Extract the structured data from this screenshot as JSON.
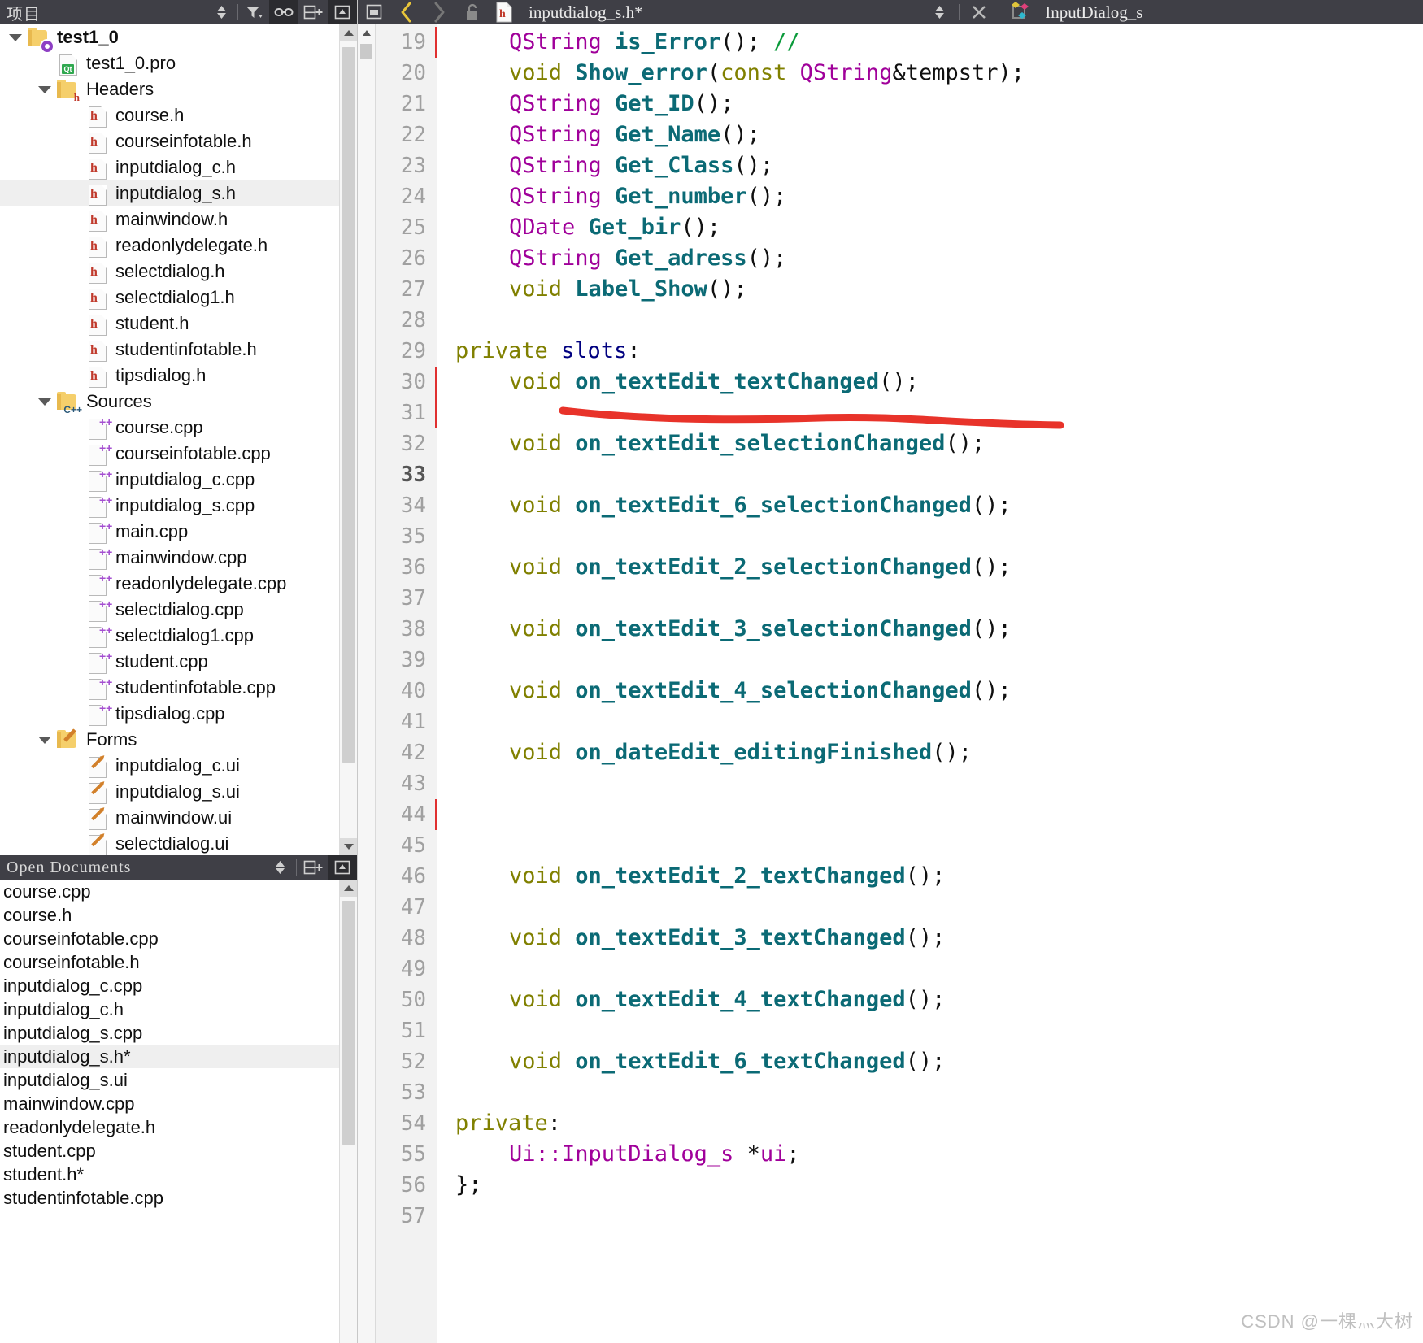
{
  "sidebar": {
    "project_panel": {
      "title": "项目",
      "tools": [
        {
          "name": "sync-selector-icon",
          "glyph": "⇕"
        },
        {
          "name": "filter-icon",
          "glyph": "▼"
        },
        {
          "name": "link-icon",
          "glyph": "🔗"
        },
        {
          "name": "split-add-icon",
          "glyph": "⊞"
        },
        {
          "name": "close-panel-icon",
          "glyph": "▣"
        }
      ]
    },
    "tree": [
      {
        "depth": 0,
        "label": "test1_0",
        "icon": "folder-project",
        "expanded": true,
        "bold": true,
        "selected": false
      },
      {
        "depth": 1,
        "label": "test1_0.pro",
        "icon": "file-pro",
        "expanded": null,
        "bold": false,
        "selected": false
      },
      {
        "depth": 1,
        "label": "Headers",
        "icon": "folder-headers",
        "expanded": true,
        "bold": false,
        "selected": false
      },
      {
        "depth": 2,
        "label": "course.h",
        "icon": "file-h",
        "expanded": null,
        "bold": false,
        "selected": false
      },
      {
        "depth": 2,
        "label": "courseinfotable.h",
        "icon": "file-h",
        "expanded": null,
        "bold": false,
        "selected": false
      },
      {
        "depth": 2,
        "label": "inputdialog_c.h",
        "icon": "file-h",
        "expanded": null,
        "bold": false,
        "selected": false
      },
      {
        "depth": 2,
        "label": "inputdialog_s.h",
        "icon": "file-h",
        "expanded": null,
        "bold": false,
        "selected": true
      },
      {
        "depth": 2,
        "label": "mainwindow.h",
        "icon": "file-h",
        "expanded": null,
        "bold": false,
        "selected": false
      },
      {
        "depth": 2,
        "label": "readonlydelegate.h",
        "icon": "file-h",
        "expanded": null,
        "bold": false,
        "selected": false
      },
      {
        "depth": 2,
        "label": "selectdialog.h",
        "icon": "file-h",
        "expanded": null,
        "bold": false,
        "selected": false
      },
      {
        "depth": 2,
        "label": "selectdialog1.h",
        "icon": "file-h",
        "expanded": null,
        "bold": false,
        "selected": false
      },
      {
        "depth": 2,
        "label": "student.h",
        "icon": "file-h",
        "expanded": null,
        "bold": false,
        "selected": false
      },
      {
        "depth": 2,
        "label": "studentinfotable.h",
        "icon": "file-h",
        "expanded": null,
        "bold": false,
        "selected": false
      },
      {
        "depth": 2,
        "label": "tipsdialog.h",
        "icon": "file-h",
        "expanded": null,
        "bold": false,
        "selected": false
      },
      {
        "depth": 1,
        "label": "Sources",
        "icon": "folder-sources",
        "expanded": true,
        "bold": false,
        "selected": false
      },
      {
        "depth": 2,
        "label": "course.cpp",
        "icon": "file-cpp",
        "expanded": null,
        "bold": false,
        "selected": false
      },
      {
        "depth": 2,
        "label": "courseinfotable.cpp",
        "icon": "file-cpp",
        "expanded": null,
        "bold": false,
        "selected": false
      },
      {
        "depth": 2,
        "label": "inputdialog_c.cpp",
        "icon": "file-cpp",
        "expanded": null,
        "bold": false,
        "selected": false
      },
      {
        "depth": 2,
        "label": "inputdialog_s.cpp",
        "icon": "file-cpp",
        "expanded": null,
        "bold": false,
        "selected": false
      },
      {
        "depth": 2,
        "label": "main.cpp",
        "icon": "file-cpp",
        "expanded": null,
        "bold": false,
        "selected": false
      },
      {
        "depth": 2,
        "label": "mainwindow.cpp",
        "icon": "file-cpp",
        "expanded": null,
        "bold": false,
        "selected": false
      },
      {
        "depth": 2,
        "label": "readonlydelegate.cpp",
        "icon": "file-cpp",
        "expanded": null,
        "bold": false,
        "selected": false
      },
      {
        "depth": 2,
        "label": "selectdialog.cpp",
        "icon": "file-cpp",
        "expanded": null,
        "bold": false,
        "selected": false
      },
      {
        "depth": 2,
        "label": "selectdialog1.cpp",
        "icon": "file-cpp",
        "expanded": null,
        "bold": false,
        "selected": false
      },
      {
        "depth": 2,
        "label": "student.cpp",
        "icon": "file-cpp",
        "expanded": null,
        "bold": false,
        "selected": false
      },
      {
        "depth": 2,
        "label": "studentinfotable.cpp",
        "icon": "file-cpp",
        "expanded": null,
        "bold": false,
        "selected": false
      },
      {
        "depth": 2,
        "label": "tipsdialog.cpp",
        "icon": "file-cpp",
        "expanded": null,
        "bold": false,
        "selected": false
      },
      {
        "depth": 1,
        "label": "Forms",
        "icon": "folder-forms",
        "expanded": true,
        "bold": false,
        "selected": false
      },
      {
        "depth": 2,
        "label": "inputdialog_c.ui",
        "icon": "file-ui",
        "expanded": null,
        "bold": false,
        "selected": false
      },
      {
        "depth": 2,
        "label": "inputdialog_s.ui",
        "icon": "file-ui",
        "expanded": null,
        "bold": false,
        "selected": false
      },
      {
        "depth": 2,
        "label": "mainwindow.ui",
        "icon": "file-ui",
        "expanded": null,
        "bold": false,
        "selected": false
      },
      {
        "depth": 2,
        "label": "selectdialog.ui",
        "icon": "file-ui",
        "expanded": null,
        "bold": false,
        "selected": false
      }
    ],
    "open_documents_panel": {
      "title": "Open Documents",
      "tools": [
        {
          "name": "sync-selector-icon",
          "glyph": "⇕"
        },
        {
          "name": "split-add-icon",
          "glyph": "⊞"
        },
        {
          "name": "close-panel-icon",
          "glyph": "▣"
        }
      ]
    },
    "open_documents": [
      {
        "label": "course.cpp",
        "selected": false
      },
      {
        "label": "course.h",
        "selected": false
      },
      {
        "label": "courseinfotable.cpp",
        "selected": false
      },
      {
        "label": "courseinfotable.h",
        "selected": false
      },
      {
        "label": "inputdialog_c.cpp",
        "selected": false
      },
      {
        "label": "inputdialog_c.h",
        "selected": false
      },
      {
        "label": "inputdialog_s.cpp",
        "selected": false
      },
      {
        "label": "inputdialog_s.h*",
        "selected": true
      },
      {
        "label": "inputdialog_s.ui",
        "selected": false
      },
      {
        "label": "mainwindow.cpp",
        "selected": false
      },
      {
        "label": "readonlydelegate.h",
        "selected": false
      },
      {
        "label": "student.cpp",
        "selected": false
      },
      {
        "label": "student.h*",
        "selected": false
      },
      {
        "label": "studentinfotable.cpp",
        "selected": false
      }
    ]
  },
  "editor": {
    "toolbar": {
      "collapse_button": "▣",
      "back_label": "‹",
      "forward_label": "›",
      "lock_label": "🔓",
      "file_icon_letter": "h",
      "filename": "inputdialog_s.h*",
      "file_dropdown": "⇕",
      "close_label": "✕",
      "symbol_name": "InputDialog_s"
    },
    "watermark": "CSDN @一棵灬大树",
    "first_line_number": 19,
    "current_line": 33,
    "lines": [
      {
        "num": 19,
        "indent": 1,
        "tokens": [
          {
            "t": "QString ",
            "c": "t-type"
          },
          {
            "t": "is_Error",
            "c": "t-fn"
          },
          {
            "t": "(); ",
            "c": "t-plain"
          },
          {
            "t": "//",
            "c": "t-comment"
          }
        ]
      },
      {
        "num": 20,
        "indent": 1,
        "tokens": [
          {
            "t": "void ",
            "c": "t-kw"
          },
          {
            "t": "Show_error",
            "c": "t-fn"
          },
          {
            "t": "(",
            "c": "t-plain"
          },
          {
            "t": "const ",
            "c": "t-kw"
          },
          {
            "t": "QString",
            "c": "t-type"
          },
          {
            "t": "&tempstr);",
            "c": "t-plain"
          }
        ]
      },
      {
        "num": 21,
        "indent": 1,
        "tokens": [
          {
            "t": "QString ",
            "c": "t-type"
          },
          {
            "t": "Get_ID",
            "c": "t-fn"
          },
          {
            "t": "();",
            "c": "t-plain"
          }
        ]
      },
      {
        "num": 22,
        "indent": 1,
        "tokens": [
          {
            "t": "QString ",
            "c": "t-type"
          },
          {
            "t": "Get_Name",
            "c": "t-fn"
          },
          {
            "t": "();",
            "c": "t-plain"
          }
        ]
      },
      {
        "num": 23,
        "indent": 1,
        "tokens": [
          {
            "t": "QString ",
            "c": "t-type"
          },
          {
            "t": "Get_Class",
            "c": "t-fn"
          },
          {
            "t": "();",
            "c": "t-plain"
          }
        ]
      },
      {
        "num": 24,
        "indent": 1,
        "tokens": [
          {
            "t": "QString ",
            "c": "t-type"
          },
          {
            "t": "Get_number",
            "c": "t-fn"
          },
          {
            "t": "();",
            "c": "t-plain"
          }
        ]
      },
      {
        "num": 25,
        "indent": 1,
        "tokens": [
          {
            "t": "QDate ",
            "c": "t-type"
          },
          {
            "t": "Get_bir",
            "c": "t-fn"
          },
          {
            "t": "();",
            "c": "t-plain"
          }
        ]
      },
      {
        "num": 26,
        "indent": 1,
        "tokens": [
          {
            "t": "QString ",
            "c": "t-type"
          },
          {
            "t": "Get_adress",
            "c": "t-fn"
          },
          {
            "t": "();",
            "c": "t-plain"
          }
        ]
      },
      {
        "num": 27,
        "indent": 1,
        "tokens": [
          {
            "t": "void ",
            "c": "t-kw"
          },
          {
            "t": "Label_Show",
            "c": "t-fn"
          },
          {
            "t": "();",
            "c": "t-plain"
          }
        ]
      },
      {
        "num": 28,
        "indent": 0,
        "tokens": []
      },
      {
        "num": 29,
        "indent": 0,
        "tokens": [
          {
            "t": "private ",
            "c": "t-kw"
          },
          {
            "t": "slots",
            "c": "t-kw2"
          },
          {
            "t": ":",
            "c": "t-plain"
          }
        ]
      },
      {
        "num": 30,
        "indent": 1,
        "tokens": [
          {
            "t": "void ",
            "c": "t-kw"
          },
          {
            "t": "on_textEdit_textChanged",
            "c": "t-fn"
          },
          {
            "t": "();",
            "c": "t-plain"
          }
        ]
      },
      {
        "num": 31,
        "indent": 0,
        "tokens": []
      },
      {
        "num": 32,
        "indent": 1,
        "tokens": [
          {
            "t": "void ",
            "c": "t-kw"
          },
          {
            "t": "on_textEdit_selectionChanged",
            "c": "t-fn"
          },
          {
            "t": "();",
            "c": "t-plain"
          }
        ]
      },
      {
        "num": 33,
        "indent": 0,
        "tokens": []
      },
      {
        "num": 34,
        "indent": 1,
        "tokens": [
          {
            "t": "void ",
            "c": "t-kw"
          },
          {
            "t": "on_textEdit_6_selectionChanged",
            "c": "t-fn"
          },
          {
            "t": "();",
            "c": "t-plain"
          }
        ]
      },
      {
        "num": 35,
        "indent": 0,
        "tokens": []
      },
      {
        "num": 36,
        "indent": 1,
        "tokens": [
          {
            "t": "void ",
            "c": "t-kw"
          },
          {
            "t": "on_textEdit_2_selectionChanged",
            "c": "t-fn"
          },
          {
            "t": "();",
            "c": "t-plain"
          }
        ]
      },
      {
        "num": 37,
        "indent": 0,
        "tokens": []
      },
      {
        "num": 38,
        "indent": 1,
        "tokens": [
          {
            "t": "void ",
            "c": "t-kw"
          },
          {
            "t": "on_textEdit_3_selectionChanged",
            "c": "t-fn"
          },
          {
            "t": "();",
            "c": "t-plain"
          }
        ]
      },
      {
        "num": 39,
        "indent": 0,
        "tokens": []
      },
      {
        "num": 40,
        "indent": 1,
        "tokens": [
          {
            "t": "void ",
            "c": "t-kw"
          },
          {
            "t": "on_textEdit_4_selectionChanged",
            "c": "t-fn"
          },
          {
            "t": "();",
            "c": "t-plain"
          }
        ]
      },
      {
        "num": 41,
        "indent": 0,
        "tokens": []
      },
      {
        "num": 42,
        "indent": 1,
        "tokens": [
          {
            "t": "void ",
            "c": "t-kw"
          },
          {
            "t": "on_dateEdit_editingFinished",
            "c": "t-fn"
          },
          {
            "t": "();",
            "c": "t-plain"
          }
        ]
      },
      {
        "num": 43,
        "indent": 0,
        "tokens": []
      },
      {
        "num": 44,
        "indent": 0,
        "tokens": []
      },
      {
        "num": 45,
        "indent": 0,
        "tokens": []
      },
      {
        "num": 46,
        "indent": 1,
        "tokens": [
          {
            "t": "void ",
            "c": "t-kw"
          },
          {
            "t": "on_textEdit_2_textChanged",
            "c": "t-fn"
          },
          {
            "t": "();",
            "c": "t-plain"
          }
        ]
      },
      {
        "num": 47,
        "indent": 0,
        "tokens": []
      },
      {
        "num": 48,
        "indent": 1,
        "tokens": [
          {
            "t": "void ",
            "c": "t-kw"
          },
          {
            "t": "on_textEdit_3_textChanged",
            "c": "t-fn"
          },
          {
            "t": "();",
            "c": "t-plain"
          }
        ]
      },
      {
        "num": 49,
        "indent": 0,
        "tokens": []
      },
      {
        "num": 50,
        "indent": 1,
        "tokens": [
          {
            "t": "void ",
            "c": "t-kw"
          },
          {
            "t": "on_textEdit_4_textChanged",
            "c": "t-fn"
          },
          {
            "t": "();",
            "c": "t-plain"
          }
        ]
      },
      {
        "num": 51,
        "indent": 0,
        "tokens": []
      },
      {
        "num": 52,
        "indent": 1,
        "tokens": [
          {
            "t": "void ",
            "c": "t-kw"
          },
          {
            "t": "on_textEdit_6_textChanged",
            "c": "t-fn"
          },
          {
            "t": "();",
            "c": "t-plain"
          }
        ]
      },
      {
        "num": 53,
        "indent": 0,
        "tokens": []
      },
      {
        "num": 54,
        "indent": 0,
        "tokens": [
          {
            "t": "private",
            "c": "t-kw"
          },
          {
            "t": ":",
            "c": "t-plain"
          }
        ]
      },
      {
        "num": 55,
        "indent": 1,
        "tokens": [
          {
            "t": "Ui::InputDialog_s ",
            "c": "t-type"
          },
          {
            "t": "*",
            "c": "t-plain"
          },
          {
            "t": "ui",
            "c": "t-var"
          },
          {
            "t": ";",
            "c": "t-plain"
          }
        ]
      },
      {
        "num": 56,
        "indent": 0,
        "tokens": [
          {
            "t": "};",
            "c": "t-plain"
          }
        ]
      },
      {
        "num": 57,
        "indent": 0,
        "tokens": []
      }
    ],
    "change_markers": [
      19,
      30,
      31,
      44
    ],
    "annotation": {
      "name": "red-underline-annotation",
      "color": "#e8332a",
      "target_line": 30
    }
  }
}
